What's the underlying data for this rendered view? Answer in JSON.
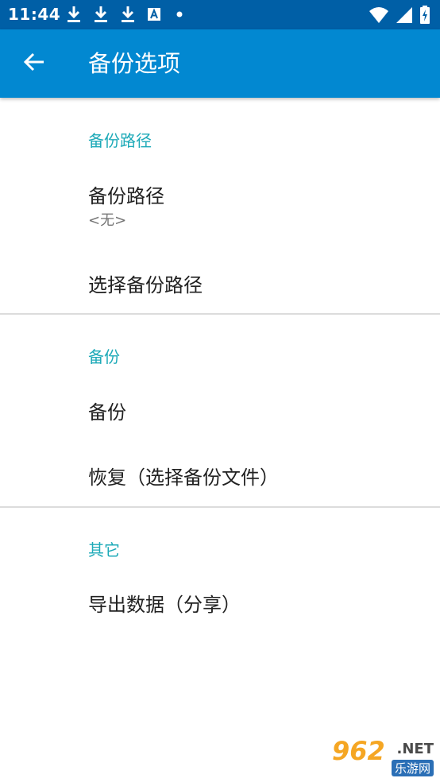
{
  "status_bar": {
    "time": "11:44",
    "left_icons": [
      "download-icon",
      "download-icon",
      "download-icon",
      "font-icon",
      "dot-icon"
    ],
    "right_icons": [
      "wifi-icon",
      "signal-icon",
      "battery-icon"
    ]
  },
  "app_bar": {
    "title": "备份选项",
    "back_icon": "arrow-back-icon"
  },
  "sections": {
    "path": {
      "header": "备份路径",
      "item_title": "备份路径",
      "item_summary": "<无>",
      "choose_title": "选择备份路径"
    },
    "backup": {
      "header": "备份",
      "backup_title": "备份",
      "restore_title": "恢复（选择备份文件）"
    },
    "other": {
      "header": "其它",
      "export_title": "导出数据（分享）"
    }
  },
  "watermark": {
    "number": "962",
    "suffix": ".NET",
    "cn": "乐游网"
  },
  "colors": {
    "status_bar": "#005fa6",
    "app_bar": "#0288d1",
    "accent": "#1eaab8"
  }
}
